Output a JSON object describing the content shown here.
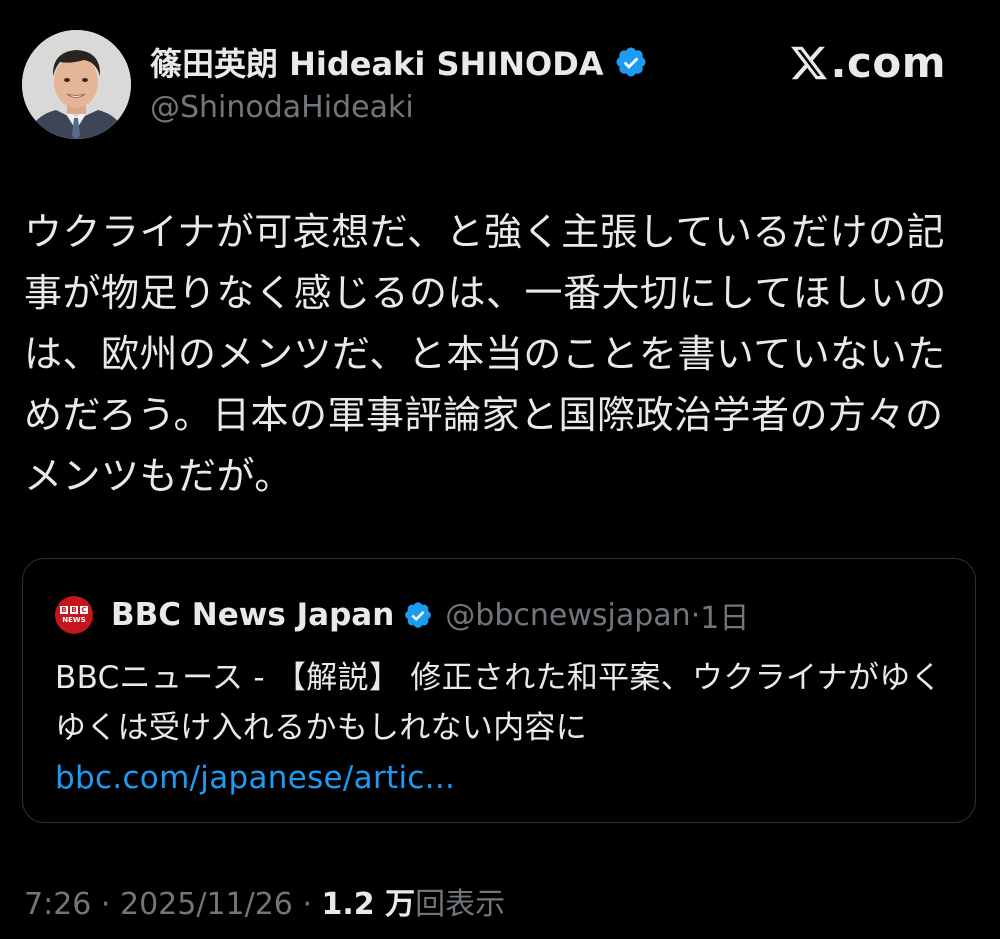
{
  "author": {
    "name": "篠田英朗 Hideaki SHINODA",
    "handle": "@ShinodaHideaki",
    "verified": true
  },
  "site": {
    "label": ".com"
  },
  "tweet": {
    "text": "ウクライナが可哀想だ、と強く主張しているだけの記事が物足りなく感じるのは、一番大切にしてほしいのは、欧州のメンツだ、と本当のことを書いていないためだろう。日本の軍事評論家と国際政治学者の方々のメンツもだが。"
  },
  "quote": {
    "name": "BBC News Japan",
    "handle": "@bbcnewsjapan",
    "separator": "·",
    "time": "1日",
    "text": "BBCニュース - 【解説】 修正された和平案、ウクライナがゆくゆくは受け入れるかもしれない内容に",
    "link": "bbc.com/japanese/artic...",
    "logo_blocks": [
      "B",
      "B",
      "C"
    ],
    "logo_word": "NEWS"
  },
  "meta": {
    "time": "7:26",
    "sep1": " · ",
    "date": "2025/11/26",
    "sep2": " · ",
    "views_count": "1.2 万",
    "views_label": "回表示"
  },
  "colors": {
    "background": "#000000",
    "text": "#e7e9ea",
    "muted": "#71767b",
    "accent": "#1d9bf0",
    "verified": "#1d9bf0",
    "bbc_red": "#c4161c",
    "border": "#2f3336"
  },
  "icons": {
    "verified": "verified-badge-icon",
    "x_logo": "x-logo-icon",
    "bbc_logo": "bbc-news-logo-icon"
  }
}
